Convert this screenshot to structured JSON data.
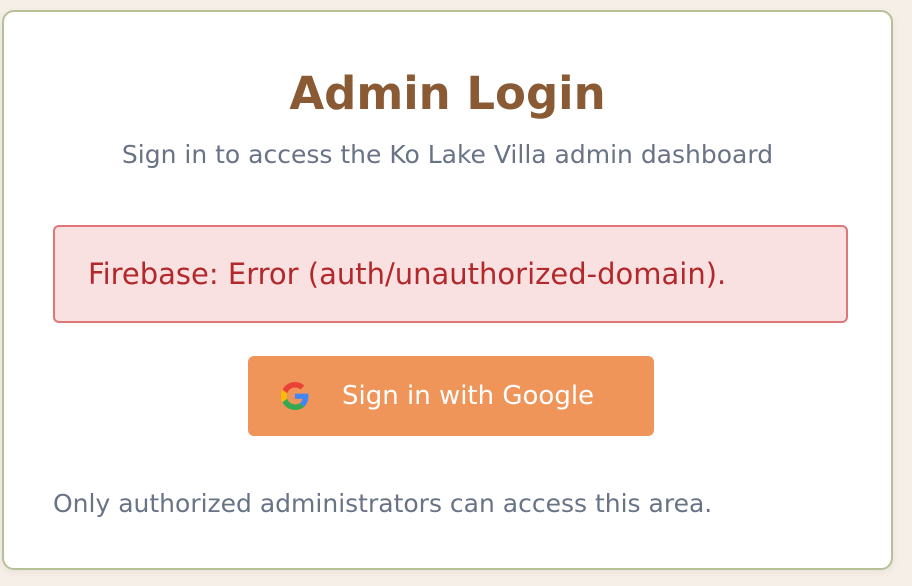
{
  "login": {
    "title": "Admin Login",
    "subtitle": "Sign in to access the Ko Lake Villa admin dashboard",
    "error_message": "Firebase: Error (auth/unauthorized-domain).",
    "google_button_label": "Sign in with Google",
    "google_icon": "google-g-icon",
    "footer_note": "Only authorized administrators can access this area."
  },
  "colors": {
    "page_background": "#f6efe7",
    "card_border": "#b7c197",
    "title": "#8a5a35",
    "muted_text": "#697386",
    "error_background": "#f9e1e1",
    "error_border": "#e07777",
    "error_text": "#b3282b",
    "button_background": "#f0955a",
    "button_text": "#ffffff"
  }
}
